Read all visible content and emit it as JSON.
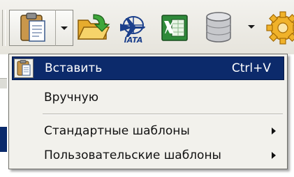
{
  "toolbar": {
    "buttons": [
      {
        "name": "paste-button",
        "icon": "clipboard-icon",
        "has_dropdown": true
      },
      {
        "name": "open-folder-button",
        "icon": "folder-open-icon"
      },
      {
        "name": "iata-button",
        "icon": "iata-logo-icon",
        "label": "IATA"
      },
      {
        "name": "excel-button",
        "icon": "excel-icon"
      },
      {
        "name": "database-button",
        "icon": "database-icon",
        "has_dropdown": true
      },
      {
        "name": "settings-button",
        "icon": "gear-icon"
      }
    ]
  },
  "menu": {
    "items": [
      {
        "label": "Вставить",
        "shortcut": "Ctrl+V",
        "icon": "clipboard-icon",
        "selected": true
      },
      {
        "label": "Вручную"
      },
      {
        "label": "Стандартные шаблоны",
        "submenu": true
      },
      {
        "label": "Пользовательские шаблоны",
        "submenu": true
      }
    ]
  },
  "colors": {
    "selection": "#0c2a6b",
    "menu_bg": "#f2f1ec",
    "toolbar_bg": "#e9e7e0"
  }
}
